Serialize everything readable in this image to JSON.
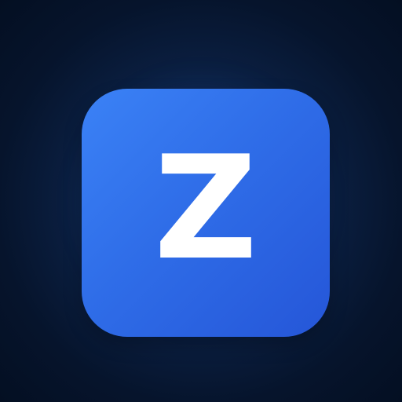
{
  "app_icon": {
    "letter": "Z"
  },
  "colors": {
    "background_center": "#123a78",
    "background_edge": "#040f22",
    "icon_gradient_start": "#3b82f6",
    "icon_gradient_end": "#2556d8",
    "letter": "#ffffff"
  }
}
